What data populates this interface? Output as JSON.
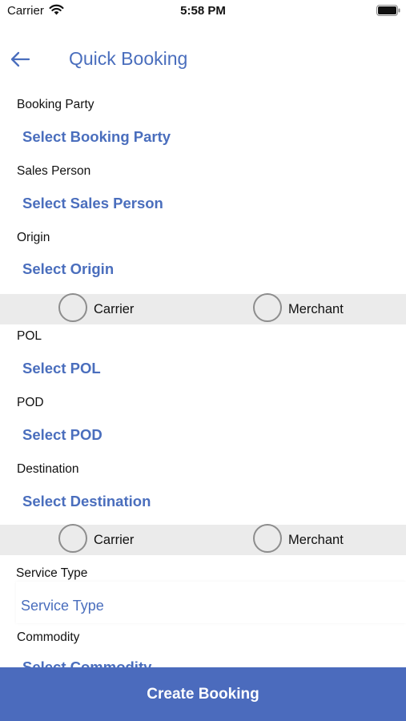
{
  "status_bar": {
    "carrier": "Carrier",
    "time": "5:58 PM"
  },
  "header": {
    "title": "Quick Booking",
    "back_icon": "arrow-left-icon"
  },
  "form": {
    "booking_party": {
      "label": "Booking Party",
      "value": "Select Booking Party"
    },
    "sales_person": {
      "label": "Sales Person",
      "value": "Select Sales Person"
    },
    "origin": {
      "label": "Origin",
      "value": "Select Origin"
    },
    "origin_haulage": {
      "option_1": "Carrier",
      "option_2": "Merchant"
    },
    "pol": {
      "label": "POL",
      "value": "Select POL"
    },
    "pod": {
      "label": "POD",
      "value": "Select POD"
    },
    "destination": {
      "label": "Destination",
      "value": "Select Destination"
    },
    "destination_haulage": {
      "option_1": "Carrier",
      "option_2": "Merchant"
    },
    "service_type": {
      "label": "Service Type",
      "placeholder": "Service Type"
    },
    "commodity": {
      "label": "Commodity",
      "value": "Select Commodity"
    }
  },
  "footer": {
    "create_label": "Create Booking"
  },
  "colors": {
    "accent": "#4a6ebd",
    "button": "#4b6bbd",
    "radio_band": "#ebebeb"
  }
}
